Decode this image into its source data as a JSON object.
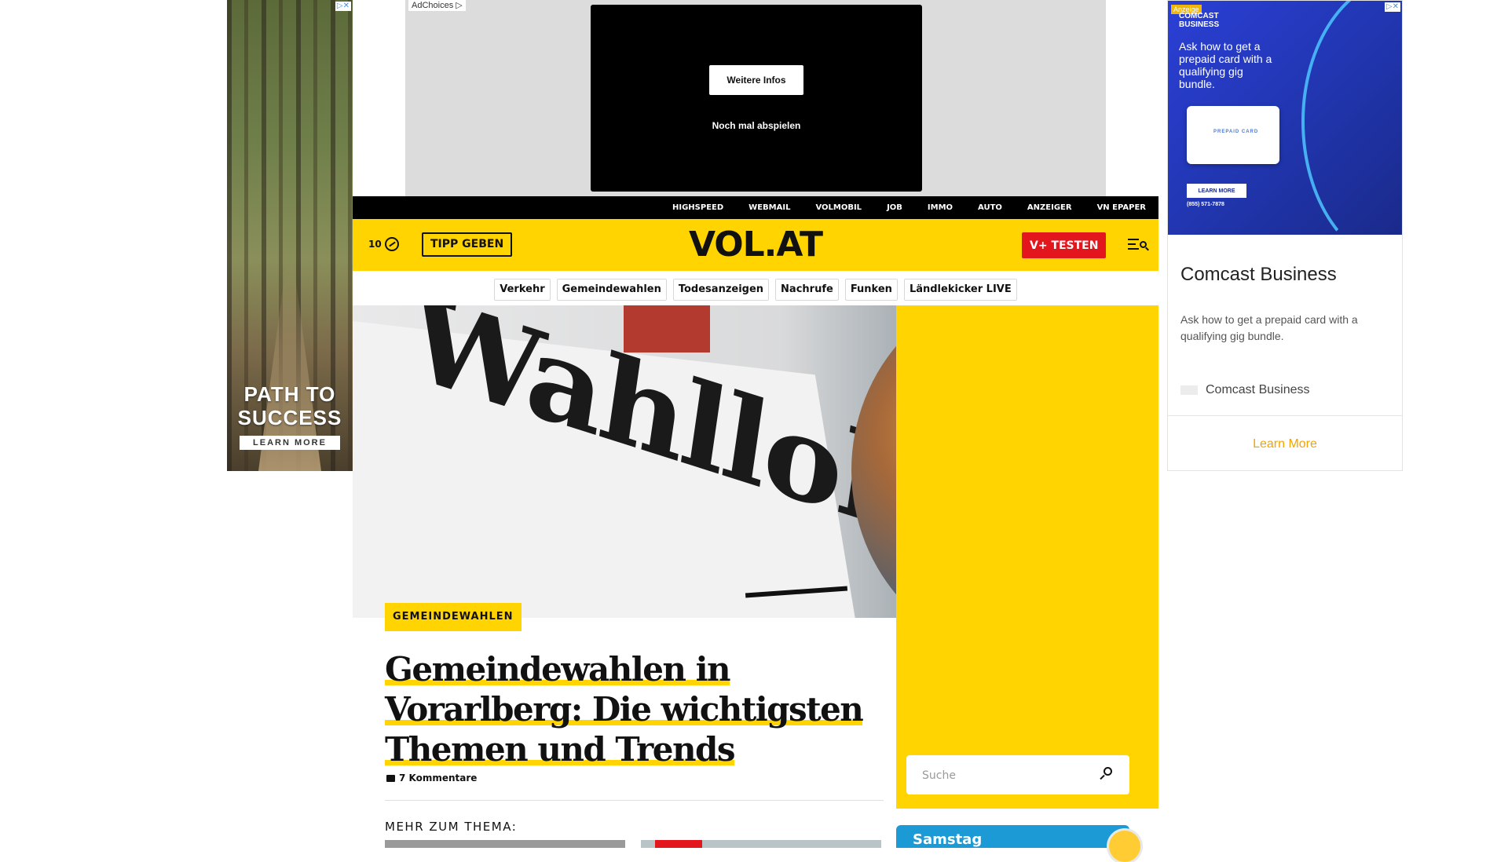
{
  "left_ad": {
    "headline": "PATH TO SUCCESS",
    "cta": "LEARN MORE",
    "close": "▷✕"
  },
  "top_ad": {
    "adchoices": "AdChoices ▷",
    "more_button": "Weitere Infos",
    "replay": "Noch mal abspielen"
  },
  "service_nav": [
    "HIGHSPEED",
    "WEBMAIL",
    "VOLMOBIL",
    "JOB",
    "IMMO",
    "AUTO",
    "ANZEIGER",
    "VN EPAPER"
  ],
  "header": {
    "temperature": "10",
    "tipp_label": "TIPP GEBEN",
    "logo": "VOL.AT",
    "vplus_label": "V+ TESTEN",
    "menu_icon": "menu-search-icon"
  },
  "topics": [
    "Verkehr",
    "Gemeindewahlen",
    "Todesanzeigen",
    "Nachrufe",
    "Funken",
    "Ländlekicker LIVE"
  ],
  "hero": {
    "sign_text": "Wahllokal"
  },
  "article": {
    "category": "GEMEINDEWAHLEN",
    "title": "Gemeindewahlen in Vorarlberg: Die wichtigsten Themen und Trends",
    "comments": "7 Kommentare",
    "more_heading": "MEHR ZUM THEMA:"
  },
  "search": {
    "placeholder": "Suche"
  },
  "weather": {
    "label": "Samstag"
  },
  "right_ad": {
    "badge": "Anzeige",
    "brand": "COMCAST\nBUSINESS",
    "ask": "Ask how to get a prepaid card with a qualifying gig bundle.",
    "card_label": "PREPAID CARD",
    "learn_btn": "LEARN MORE",
    "phone": "(855) 571-7878",
    "close": "▷✕",
    "title": "Comcast Business",
    "description": "Ask how to get a prepaid card with a qualifying gig bundle.",
    "advertiser": "Comcast Business",
    "learn_more": "Learn More"
  },
  "colors": {
    "brand_yellow": "#ffd400",
    "accent_red": "#e3161e",
    "weather_blue": "#1c9ad6",
    "ad_link_orange": "#f0a500"
  }
}
